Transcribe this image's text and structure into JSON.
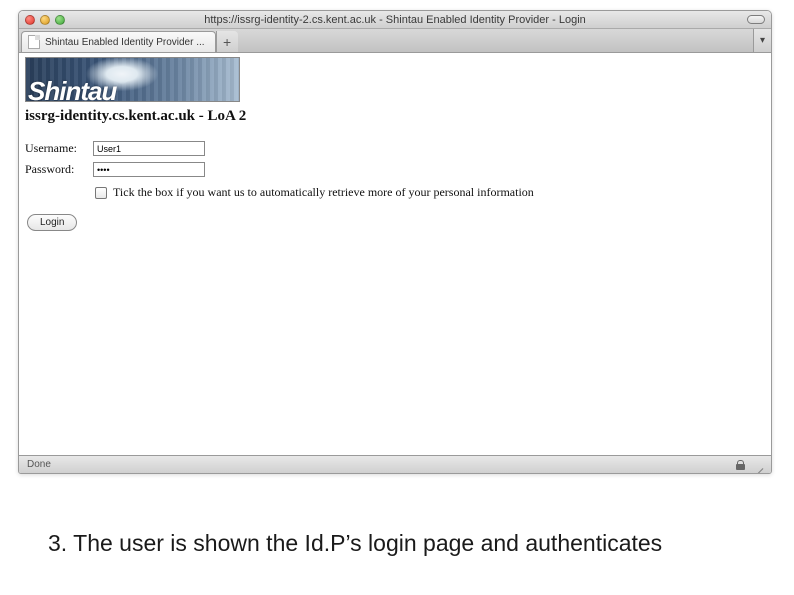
{
  "window": {
    "title": "https://issrg-identity-2.cs.kent.ac.uk - Shintau Enabled Identity Provider - Login"
  },
  "tab": {
    "label": "Shintau Enabled Identity Provider ..."
  },
  "banner": {
    "brand": "Shintau"
  },
  "page": {
    "heading": "issrg-identity.cs.kent.ac.uk - LoA 2"
  },
  "form": {
    "username_label": "Username:",
    "username_value": "User1",
    "password_label": "Password:",
    "password_value": "••••",
    "checkbox_label": "Tick the box if you want us to automatically retrieve more of your personal information",
    "login_label": "Login"
  },
  "status": {
    "text": "Done"
  },
  "caption": "3. The user is shown the Id.P’s login page and authenticates"
}
